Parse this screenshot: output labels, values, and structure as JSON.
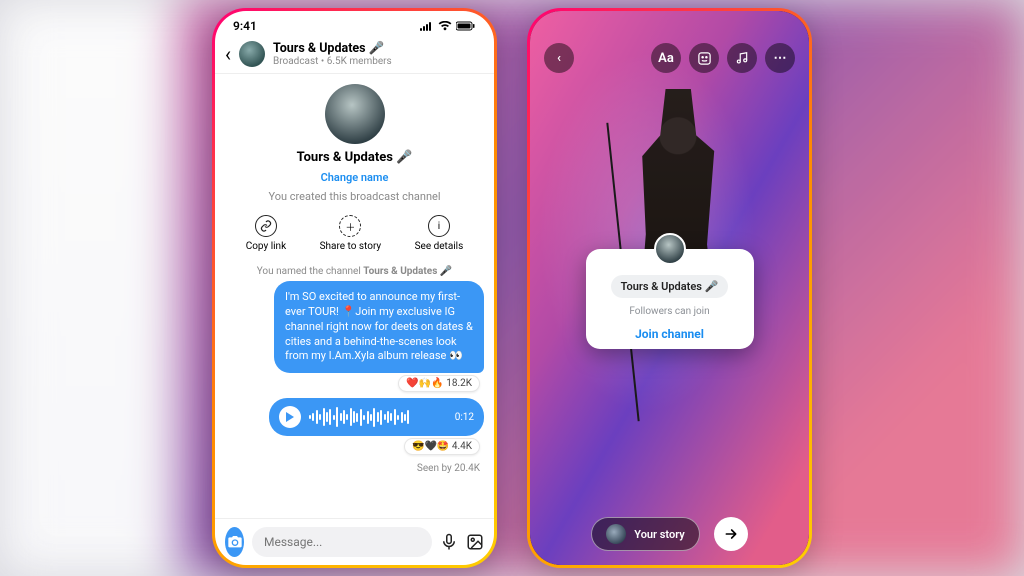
{
  "status_time": "9:41",
  "phone1": {
    "header": {
      "title": "Tours & Updates 🎤",
      "sub": "Broadcast • 6.5K members"
    },
    "channel": {
      "name": "Tours & Updates 🎤",
      "change": "Change name",
      "system": "You created this broadcast channel",
      "actions": {
        "copy": "Copy link",
        "share": "Share to story",
        "details": "See details"
      },
      "named_prefix": "You named the channel ",
      "named_value": "Tours & Updates 🎤"
    },
    "msg1": {
      "text": "I'm SO excited to announce my first-ever TOUR! 📍Join my exclusive IG channel right now for deets on dates & cities and a behind-the-scenes look from my I.Am.Xyla album release 👀",
      "reactions": "❤️🙌🔥 18.2K"
    },
    "voice": {
      "time": "0:12",
      "reactions": "😎🖤🤩 4.4K"
    },
    "seen": "Seen by 20.4K",
    "composer": {
      "placeholder": "Message..."
    }
  },
  "phone2": {
    "tools": {
      "text": "Aa"
    },
    "card": {
      "title": "Tours & Updates 🎤",
      "sub": "Followers can join",
      "button": "Join channel"
    },
    "footer": {
      "label": "Your story"
    }
  }
}
